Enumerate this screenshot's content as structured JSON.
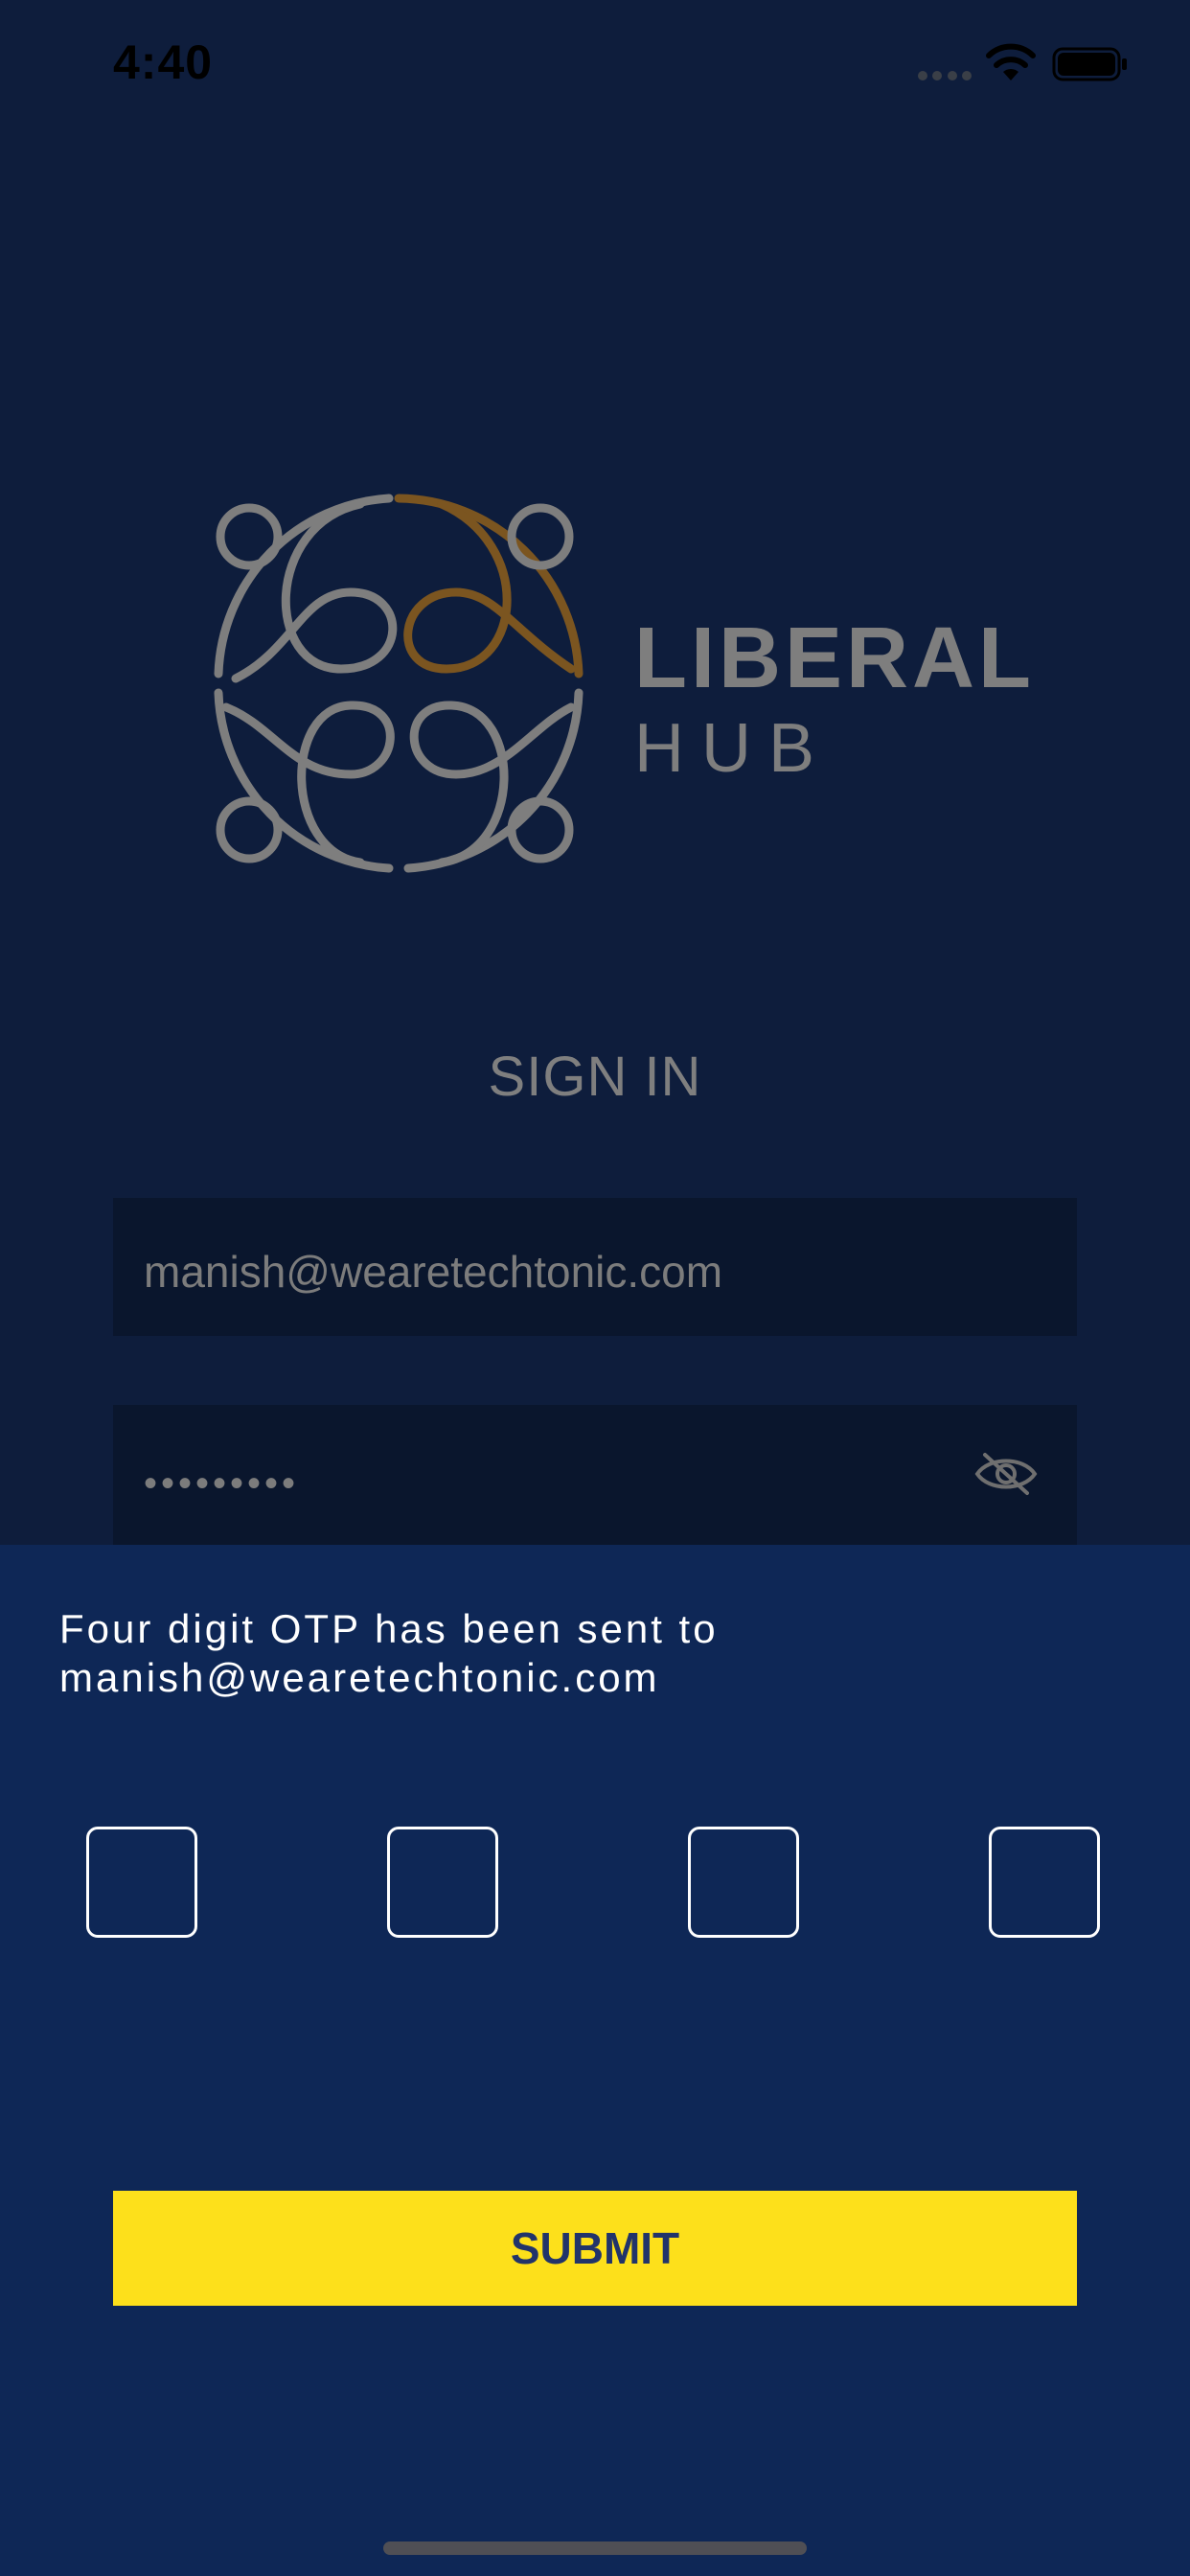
{
  "status_bar": {
    "time": "4:40",
    "icons": [
      "cellular-dots-icon",
      "wifi-icon",
      "battery-icon"
    ]
  },
  "logo": {
    "brand_line1": "LIBERAL",
    "brand_line2": "HUB",
    "colors": {
      "gray": "#7e7e7e",
      "gold": "#7b5520"
    }
  },
  "sign_in": {
    "title": "SIGN IN",
    "email_value": "manish@wearetechtonic.com",
    "password_value": "•••••••••",
    "password_toggle_icon": "eye-slash-icon"
  },
  "otp_sheet": {
    "message_line1": "Four digit OTP has been sent to",
    "message_line2": "manish@wearetechtonic.com",
    "digits": [
      "",
      "",
      "",
      ""
    ],
    "submit_label": "SUBMIT"
  },
  "colors": {
    "sheet_background": "#0e2756",
    "page_background": "#0e1d3c",
    "submit_button": "#fde01b",
    "submit_text": "#22346a",
    "otp_border": "#ffffff"
  }
}
